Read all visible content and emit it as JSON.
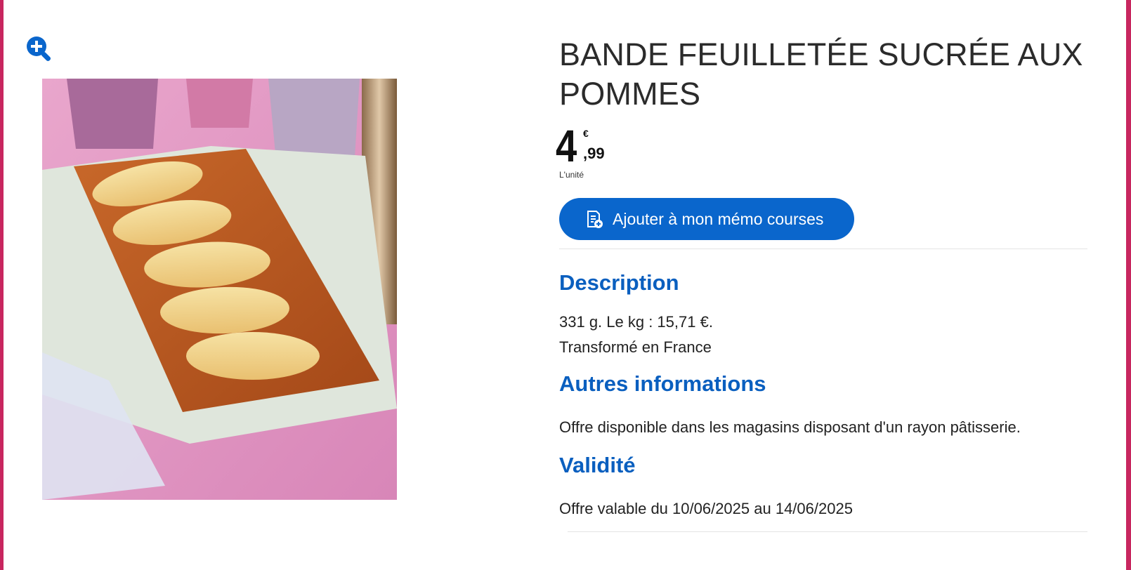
{
  "product": {
    "title": "BANDE FEUILLETÉE SUCRÉE AUX POMMES",
    "price": {
      "integer": "4",
      "currency": "€",
      "decimals": ",99",
      "unit": "L'unité"
    },
    "memo_button_label": "Ajouter à mon mémo courses"
  },
  "sections": {
    "description": {
      "title": "Description",
      "line1": "331 g. Le kg : 15,71 €.",
      "line2": "Transformé en France"
    },
    "autres": {
      "title": "Autres informations",
      "text": "Offre disponible dans les magasins disposant d'un rayon pâtisserie."
    },
    "validite": {
      "title": "Validité",
      "text": "Offre valable du 10/06/2025 au 14/06/2025"
    }
  },
  "icons": {
    "zoom": "zoom-in-icon",
    "memo": "memo-list-icon"
  },
  "colors": {
    "accent_blue": "#0a66cc",
    "section_title": "#0a5fbf",
    "frame": "#c8265f"
  }
}
